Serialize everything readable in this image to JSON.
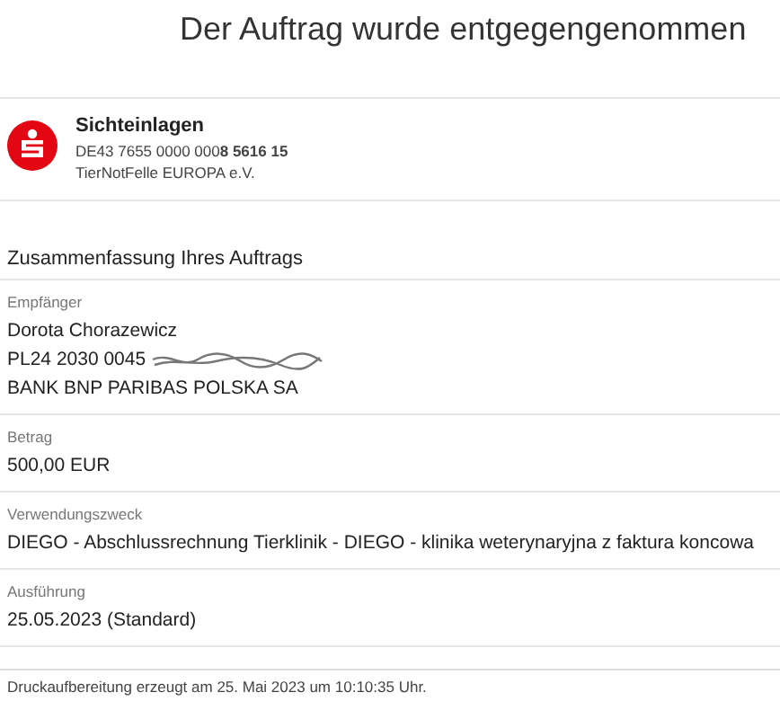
{
  "title": "Der Auftrag wurde entgegengenommen",
  "account": {
    "name": "Sichteinlagen",
    "iban": "DE43 7655 0000 000**8 5616 15**",
    "holder": "TierNotFelle EUROPA e.V."
  },
  "summary": {
    "heading": "Zusammenfassung Ihres Auftrags",
    "fields": [
      {
        "label": "Empfänger",
        "lines": [
          {
            "text": "Dorota Chorazewicz",
            "obscured": false
          },
          {
            "text": "PL24 2030 0045",
            "obscured": true
          },
          {
            "text": "BANK BNP PARIBAS POLSKA SA",
            "obscured": false
          }
        ]
      },
      {
        "label": "Betrag",
        "lines": [
          {
            "text": "500,00 EUR",
            "obscured": false
          }
        ]
      },
      {
        "label": "Verwendungszweck",
        "lines": [
          {
            "text": "DIEGO - Abschlussrechnung Tierklinik - DIEGO - klinika weterynaryjna z faktura koncowa",
            "obscured": false
          }
        ]
      },
      {
        "label": "Ausführung",
        "lines": [
          {
            "text": "25.05.2023 (Standard)",
            "obscured": false
          }
        ]
      }
    ]
  },
  "footer": "Druckaufbereitung erzeugt am 25. Mai 2023 um 10:10:35 Uhr."
}
